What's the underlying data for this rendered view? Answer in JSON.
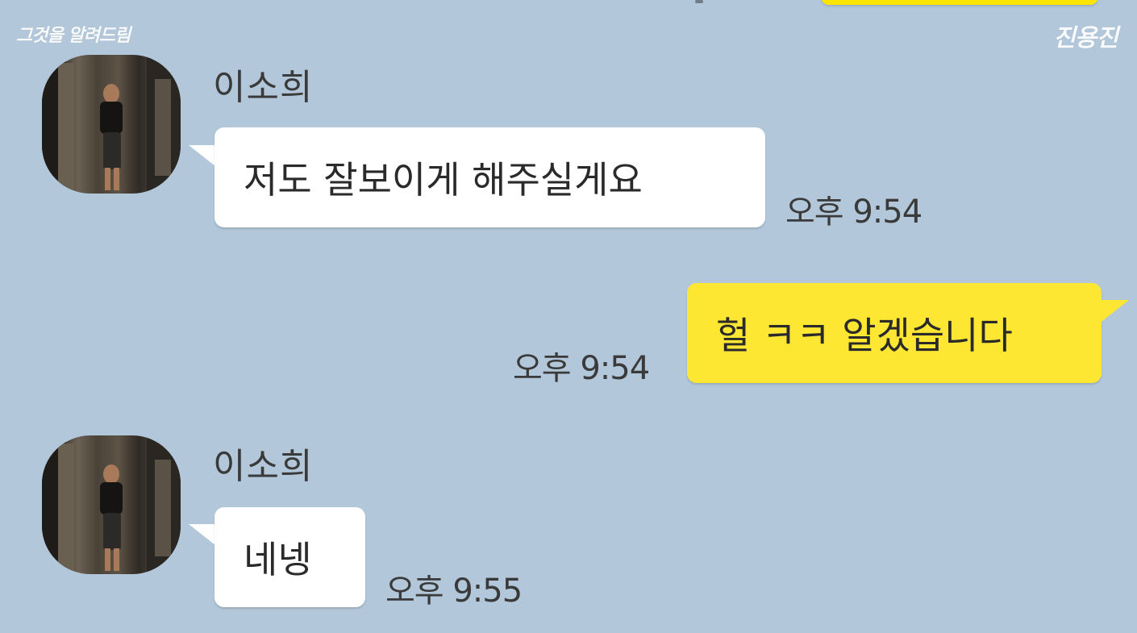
{
  "watermarks": {
    "left": "그것을 알려드림",
    "right": "진용진"
  },
  "messages": [
    {
      "direction": "incoming",
      "sender": "이소희",
      "text": "저도 잘보이게 해주실게요",
      "time": "오후 9:54"
    },
    {
      "direction": "outgoing",
      "text": "헐 ㅋㅋ 알겠습니다",
      "time": "오후 9:54"
    },
    {
      "direction": "incoming",
      "sender": "이소희",
      "text": "네넹",
      "time": "오후 9:55"
    }
  ],
  "colors": {
    "chat_background": "#b2c7d9",
    "incoming_bubble": "#ffffff",
    "outgoing_bubble": "#fee733"
  }
}
